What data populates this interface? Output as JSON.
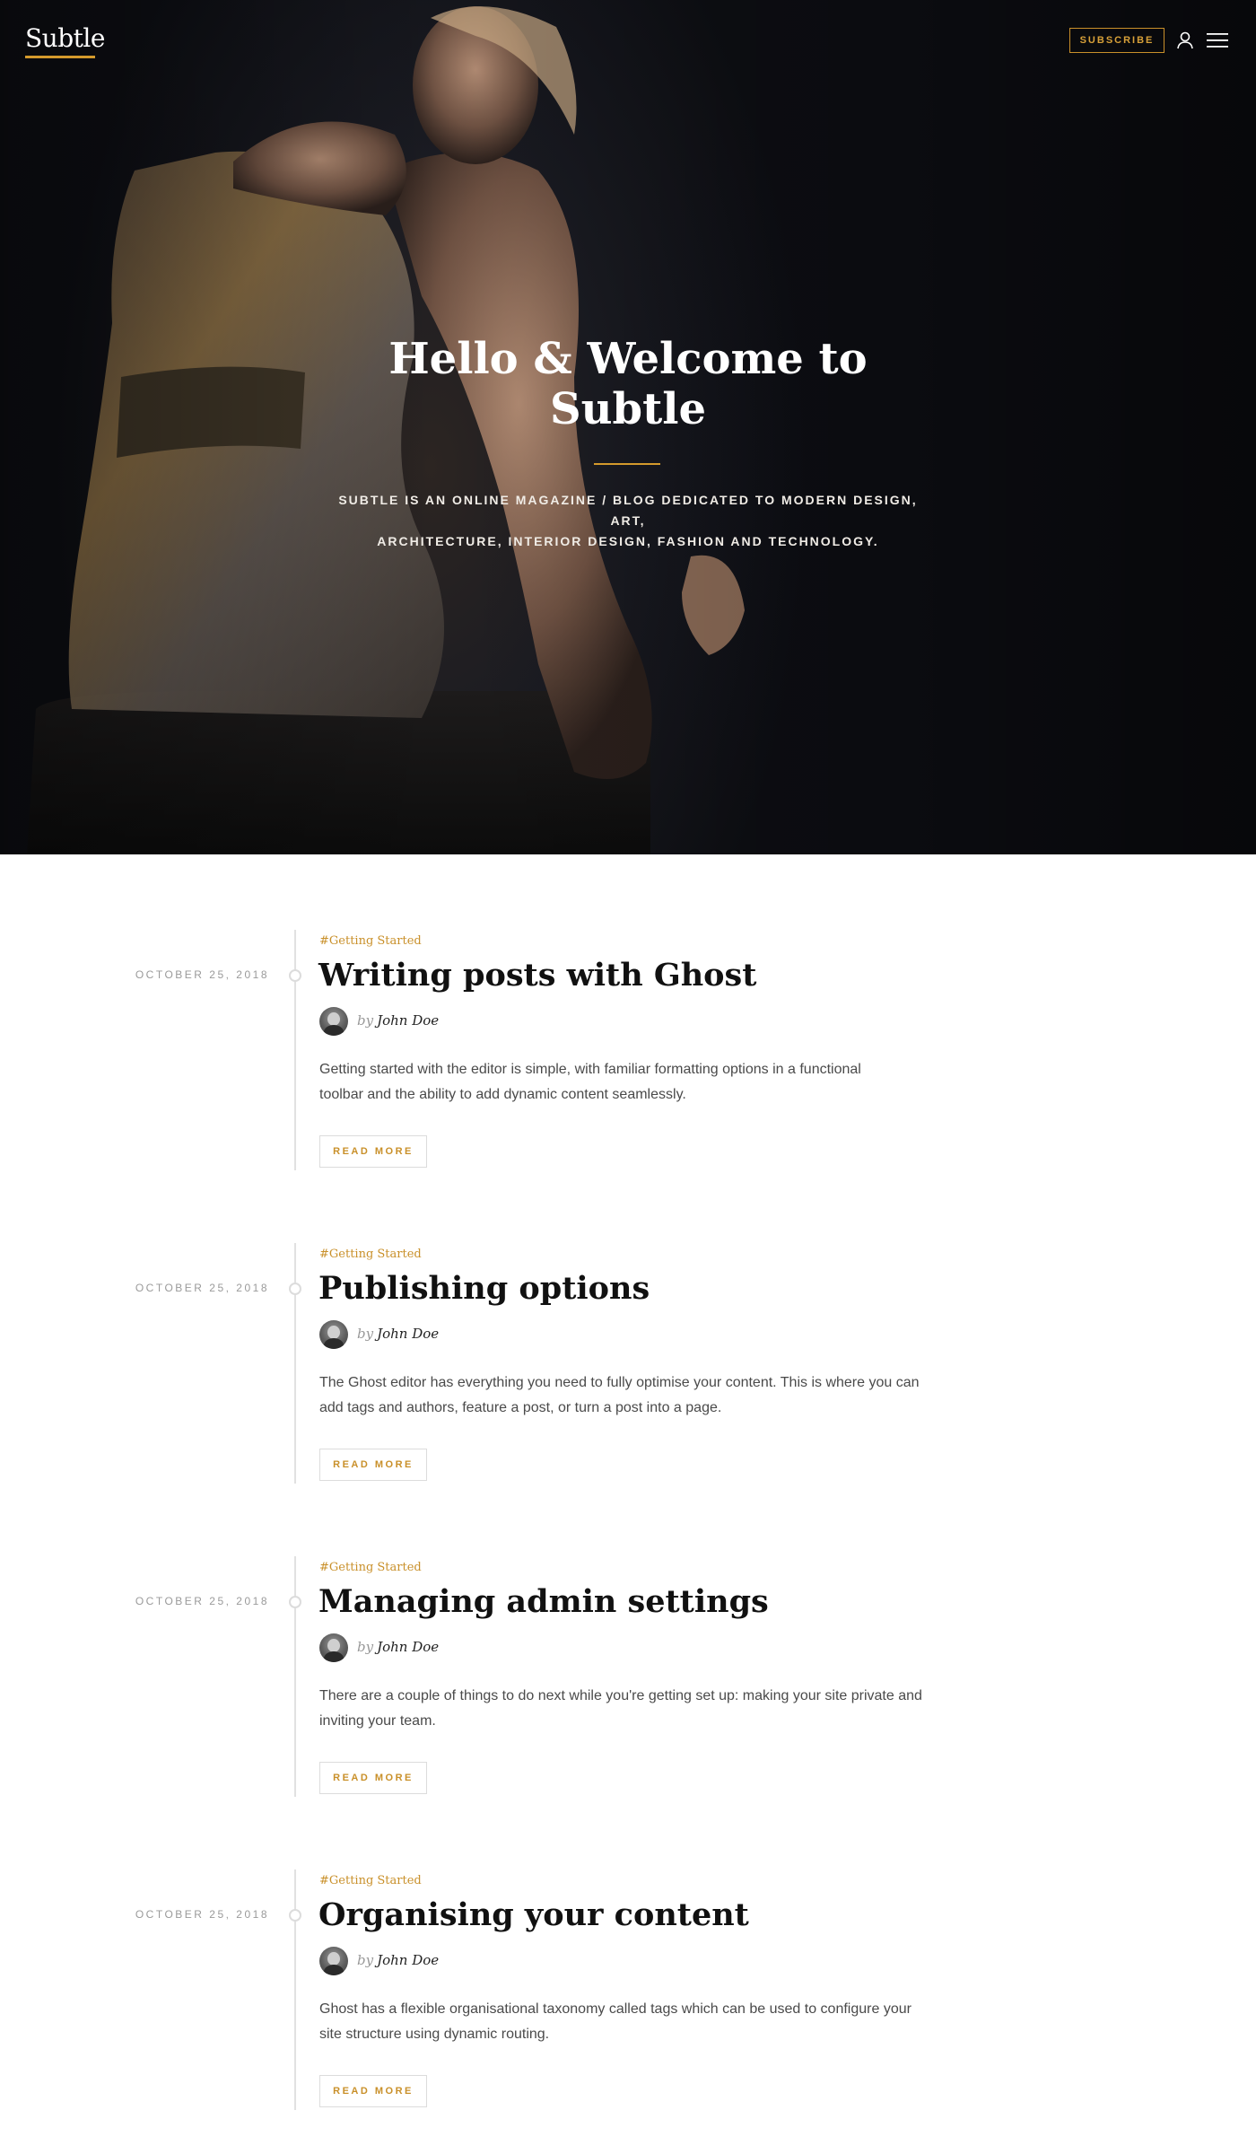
{
  "site": {
    "logo": "Subtle",
    "subscribe_label": "SUBSCRIBE",
    "user_icon": "user-icon",
    "menu_icon": "menu-icon",
    "accent_color": "#d49a2c"
  },
  "hero": {
    "title_line1": "Hello & Welcome to",
    "title_line2": "Subtle",
    "description_line1": "SUBTLE IS AN ONLINE MAGAZINE / BLOG DEDICATED TO MODERN DESIGN, ART,",
    "description_line2": "ARCHITECTURE, INTERIOR DESIGN, FASHION AND TECHNOLOGY."
  },
  "posts": [
    {
      "date": "OCTOBER 25, 2018",
      "tag": "#Getting Started",
      "title": "Writing posts with Ghost",
      "by": "by",
      "author": "John Doe",
      "excerpt_line1": "Getting started with the editor is simple, with familiar formatting options in a functional",
      "excerpt_line2": "toolbar and the ability to add dynamic content seamlessly.",
      "read_more": "READ MORE"
    },
    {
      "date": "OCTOBER 25, 2018",
      "tag": "#Getting Started",
      "title": "Publishing options",
      "by": "by",
      "author": "John Doe",
      "excerpt_line1": "The Ghost editor has everything you need to fully optimise your content. This is where you can",
      "excerpt_line2": "add tags and authors, feature a post, or turn a post into a page.",
      "read_more": "READ MORE"
    },
    {
      "date": "OCTOBER 25, 2018",
      "tag": "#Getting Started",
      "title": "Managing admin settings",
      "by": "by",
      "author": "John Doe",
      "excerpt_line1": "There are a couple of things to do next while you're getting set up: making your site private and",
      "excerpt_line2": "inviting your team.",
      "read_more": "READ MORE"
    },
    {
      "date": "OCTOBER 25, 2018",
      "tag": "#Getting Started",
      "title": "Organising your content",
      "by": "by",
      "author": "John Doe",
      "excerpt_line1": "Ghost has a flexible organisational taxonomy called tags which can be used to configure your",
      "excerpt_line2": "site structure using dynamic routing.",
      "read_more": "READ MORE"
    }
  ]
}
